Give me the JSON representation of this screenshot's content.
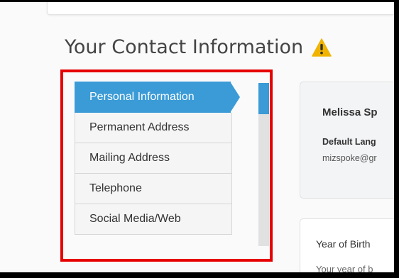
{
  "page": {
    "title": "Your Contact Information",
    "warning_icon": "warning-triangle-icon",
    "warning_color": "#f0b400"
  },
  "sidebar": {
    "active_color": "#3a9bd6",
    "items": [
      {
        "label": "Personal Information",
        "active": true
      },
      {
        "label": "Permanent Address",
        "active": false
      },
      {
        "label": "Mailing Address",
        "active": false
      },
      {
        "label": "Telephone",
        "active": false
      },
      {
        "label": "Social Media/Web",
        "active": false
      }
    ]
  },
  "highlight": {
    "color": "#e60000"
  },
  "profile": {
    "name": "Melissa Sp",
    "language_label": "Default Lang",
    "email": "mizspoke@gr"
  },
  "birth": {
    "title": "Year of Birth",
    "description": "Your year of b"
  }
}
